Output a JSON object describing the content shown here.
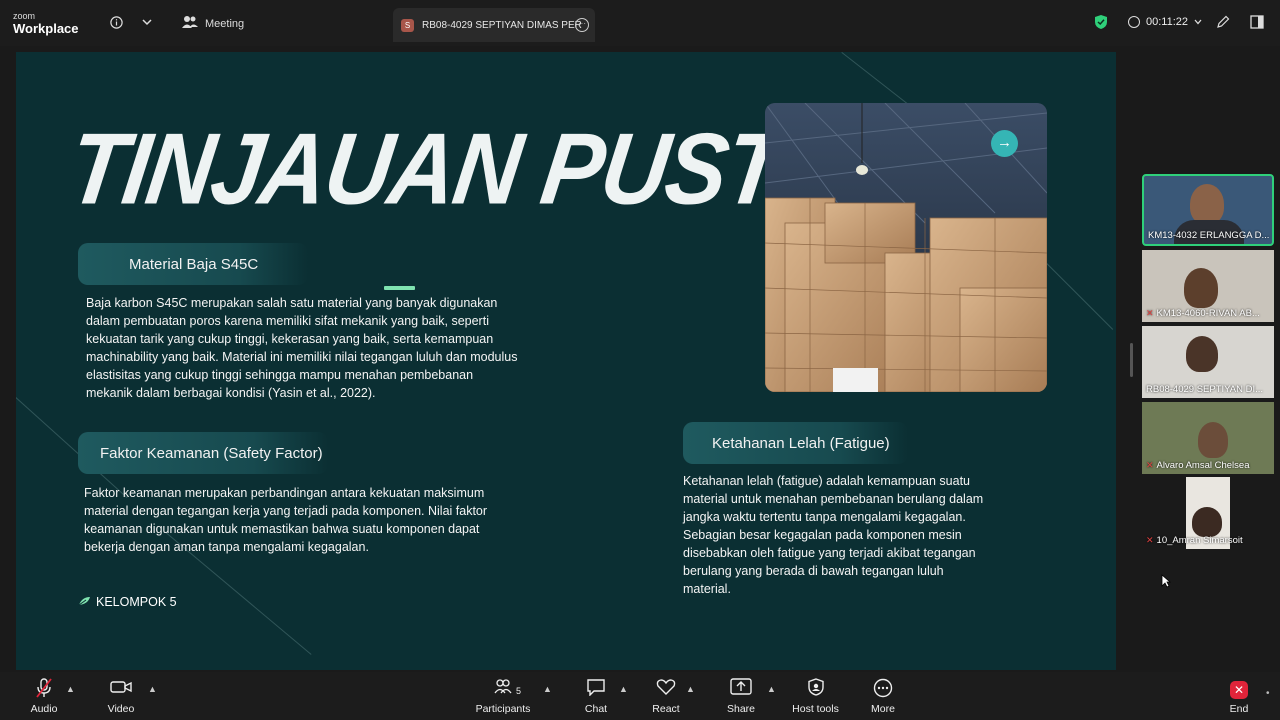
{
  "app": {
    "logo_line1": "zoom",
    "logo_line2": "Workplace"
  },
  "header": {
    "meeting_label": "Meeting",
    "active_speaker": "RB08-4029 SEPTIYAN DIMAS PER",
    "speaker_initial": "S",
    "timer": "00:11:22"
  },
  "slide": {
    "title": "TINJAUAN PUSTAKA",
    "section1": {
      "heading": "Material Baja S45C",
      "lines": [
        "Baja karbon S45C merupakan salah satu material yang banyak digunakan",
        "dalam pembuatan poros karena memiliki sifat mekanik yang baik, seperti",
        "kekuatan tarik yang cukup tinggi, kekerasan yang baik, serta kemampuan",
        "machinability yang baik. Material ini memiliki nilai tegangan luluh dan modulus",
        "elastisitas yang cukup tinggi sehingga mampu menahan pembebanan",
        "mekanik dalam berbagai kondisi (Yasin et al., 2022)."
      ]
    },
    "section2": {
      "heading": "Faktor Keamanan (Safety Factor)",
      "lines": [
        "Faktor keamanan merupakan perbandingan antara kekuatan maksimum",
        "material dengan tegangan kerja yang terjadi pada komponen. Nilai faktor",
        "keamanan digunakan untuk memastikan bahwa suatu komponen dapat",
        "bekerja dengan aman tanpa mengalami kegagalan."
      ]
    },
    "section3": {
      "heading": "Ketahanan Lelah (Fatigue)",
      "lines": [
        "Ketahanan lelah (fatigue) adalah kemampuan suatu",
        "material untuk menahan pembebanan berulang dalam",
        "jangka waktu tertentu tanpa mengalami kegagalan.",
        "Sebagian besar kegagalan pada komponen mesin",
        "disebabkan oleh fatigue yang terjadi akibat tegangan",
        "berulang yang berada di bawah tegangan luluh",
        "material."
      ]
    },
    "footer": "KELOMPOK 5"
  },
  "participants": [
    {
      "name": "KM13-4032 ERLANGGA D...",
      "muted": false,
      "active": true
    },
    {
      "name": "KM13-4060-RIVAN AB...",
      "muted": true,
      "active": false
    },
    {
      "name": "RB08-4029 SEPTIYAN DI...",
      "muted": false,
      "active": false
    },
    {
      "name": "Alvaro Amsal Chelsea",
      "muted": true,
      "active": false
    },
    {
      "name": "10_Amran Simarsoit",
      "muted": true,
      "active": false
    }
  ],
  "toolbar": {
    "audio": "Audio",
    "video": "Video",
    "participants": "Participants",
    "participants_count": "5",
    "chat": "Chat",
    "react": "React",
    "share": "Share",
    "host_tools": "Host tools",
    "more": "More",
    "end": "End"
  },
  "colors": {
    "slide_bg": "#0b2f33",
    "accent": "#7fe3b0",
    "end": "#e0243a",
    "active_tile": "#2fd07a"
  }
}
